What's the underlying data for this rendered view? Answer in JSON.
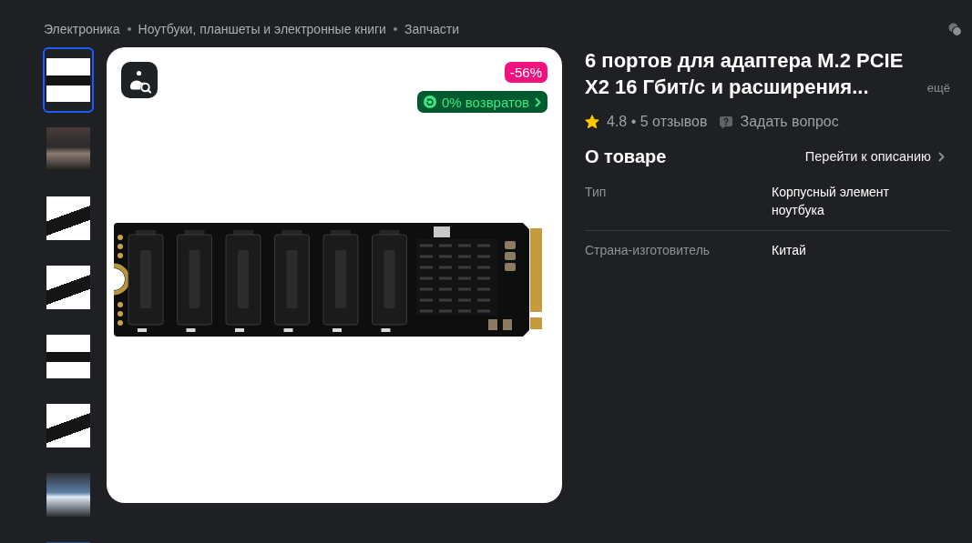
{
  "breadcrumbs": [
    "Электроника",
    "Ноутбуки, планшеты и электронные книги",
    "Запчасти"
  ],
  "gallery": {
    "thumbnails": [
      {
        "selected": true
      },
      {
        "selected": false
      },
      {
        "selected": false
      },
      {
        "selected": false
      },
      {
        "selected": false
      },
      {
        "selected": false
      },
      {
        "selected": false
      },
      {
        "selected": false
      }
    ]
  },
  "product_card": {
    "discount": "-56%",
    "returns": "0% возвратов"
  },
  "product": {
    "title": "6 портов для адаптера M.2 PCIE X2 16 Гбит/с и расширения...",
    "more_link": "ещё",
    "reviews": "4.8 • 5 отзывов",
    "ask_question": "Задать вопрос"
  },
  "about": {
    "heading": "О товаре",
    "description_link": "Перейти к описанию",
    "specs": [
      {
        "name": "Тип",
        "value": "Корпусный элемент ноутбука"
      },
      {
        "name": "Страна-изготовитель",
        "value": "Китай"
      }
    ]
  }
}
